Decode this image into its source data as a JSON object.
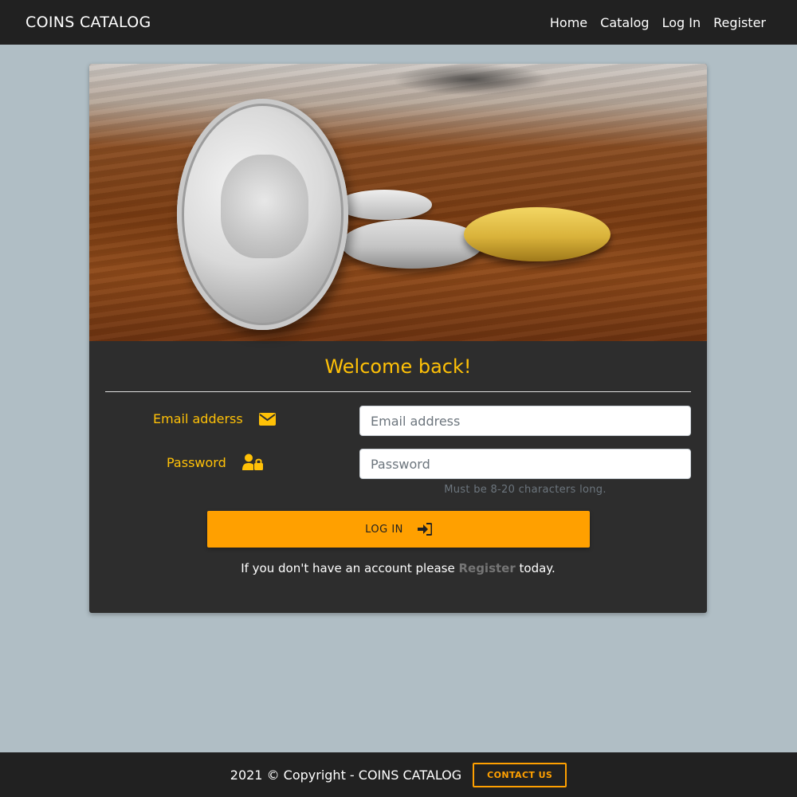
{
  "navbar": {
    "brand": "COINS CATALOG",
    "links": [
      "Home",
      "Catalog",
      "Log In",
      "Register"
    ]
  },
  "card": {
    "welcome": "Welcome back!",
    "email_label": "Email adderss",
    "email_placeholder": "Email address",
    "password_label": "Password",
    "password_placeholder": "Password",
    "password_hint": "Must be 8-20 characters long.",
    "login_button": "LOG IN",
    "register_prefix": "If you don't have an account please ",
    "register_link": "Register",
    "register_suffix": " today."
  },
  "footer": {
    "copyright": "2021 © Copyright -  COINS CATALOG",
    "contact_button": "CONTACT US"
  },
  "colors": {
    "accent": "#ffc107",
    "button": "#ffa000",
    "navbar": "#212121",
    "card": "#2d2d2d",
    "page_bg": "#b0bec5"
  },
  "icons": {
    "email": "envelope-icon",
    "password": "user-lock-icon",
    "login": "sign-in-icon"
  }
}
